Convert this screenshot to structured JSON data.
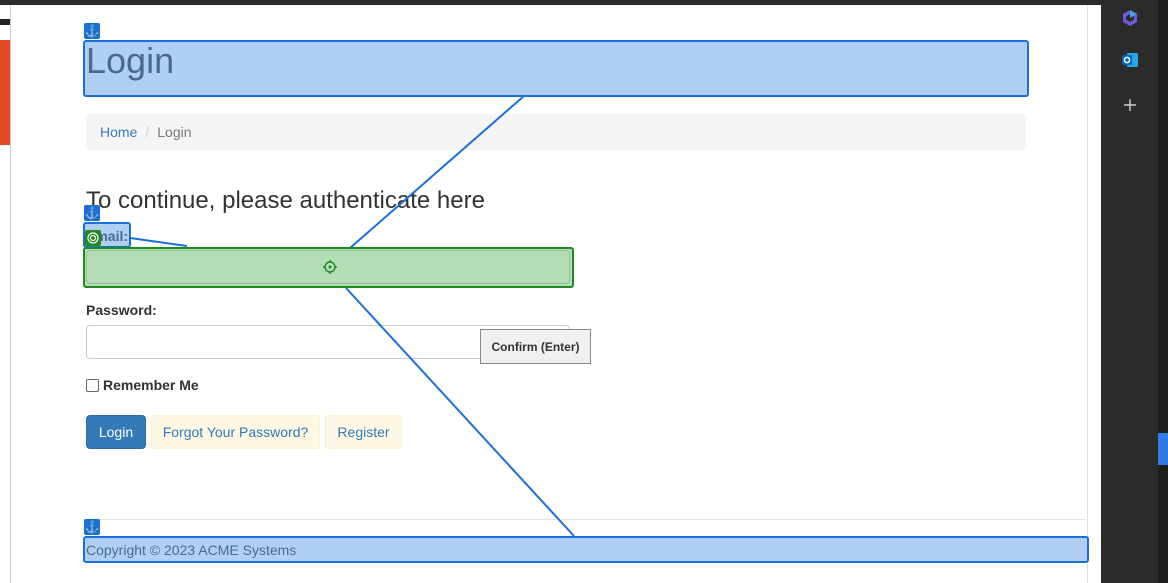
{
  "page": {
    "title": "Login",
    "breadcrumb": {
      "home": "Home",
      "separator": "/",
      "current": "Login"
    },
    "subheading": "To continue, please authenticate here"
  },
  "form": {
    "email_label": "Email:",
    "email_label_visible": "nail:",
    "email_value": "",
    "password_label": "Password:",
    "password_value": "",
    "remember_label": "Remember Me",
    "remember_checked": false,
    "login_button": "Login",
    "forgot_button": "Forgot Your Password?",
    "register_button": "Register",
    "tooltip": "Confirm (Enter)"
  },
  "footer": {
    "copyright": "Copyright © 2023 ACME Systems"
  },
  "icons": {
    "anchor": "anchor-icon",
    "target": "target-icon",
    "crosshair": "crosshair-icon",
    "copilot": "copilot-icon",
    "outlook": "outlook-icon",
    "add": "plus-icon"
  },
  "colors": {
    "primary": "#337ab7",
    "overlay_blue": "#1a6fd8",
    "overlay_green": "#1f8a1f",
    "link_button_bg": "#fcf8e3"
  }
}
